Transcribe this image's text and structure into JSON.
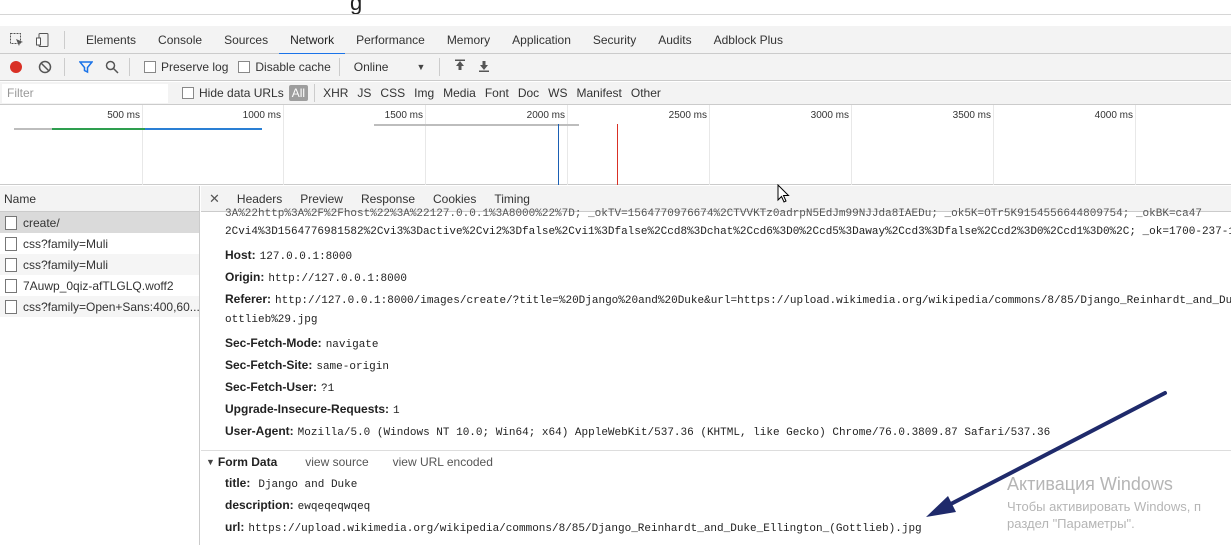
{
  "page": {
    "heading_fragment": "g"
  },
  "devtools": {
    "tabs": [
      "Elements",
      "Console",
      "Sources",
      "Network",
      "Performance",
      "Memory",
      "Application",
      "Security",
      "Audits",
      "Adblock Plus"
    ],
    "active_tab": "Network"
  },
  "toolbar": {
    "preserve_log": "Preserve log",
    "disable_cache": "Disable cache",
    "throttle": "Online"
  },
  "filter": {
    "placeholder": "Filter",
    "hide_data_urls": "Hide data URLs",
    "all": "All",
    "types": [
      "XHR",
      "JS",
      "CSS",
      "Img",
      "Media",
      "Font",
      "Doc",
      "WS",
      "Manifest",
      "Other"
    ]
  },
  "overview": {
    "ticks": [
      "500 ms",
      "1000 ms",
      "1500 ms",
      "2000 ms",
      "2500 ms",
      "3000 ms",
      "3500 ms",
      "4000 ms"
    ],
    "colors": {
      "green": "#2e9e4f",
      "blue_bar": "#2a7fd4",
      "blue_line": "#1a5fb4",
      "red_line": "#d93025"
    }
  },
  "requests": {
    "header": "Name",
    "items": [
      "create/",
      "css?family=Muli",
      "css?family=Muli",
      "7Auwp_0qiz-afTLGLQ.woff2",
      "css?family=Open+Sans:400,60..."
    ]
  },
  "detail": {
    "tabs": [
      "Headers",
      "Preview",
      "Response",
      "Cookies",
      "Timing"
    ],
    "cut_line": "3A%22http%3A%2F%2Fhost%22%3A%22127.0.0.1%3A8000%22%7D; _okTV=1564770976674%2CTVVKTz0adrpN5EdJm99NJJda8IAEDu; _ok5K=OTr5K9154556644809754; _okBK=ca47",
    "cookie_tail": "2Cvi4%3D1564776981582%2Cvi3%3Dactive%2Cvi2%3Dfalse%2Cvi1%3Dfalse%2Ccd8%3Dchat%2Ccd6%3D0%2Ccd5%3Daway%2Ccd3%3Dfalse%2Ccd2%3D0%2Ccd1%3D0%2C; _ok=1700-237-1",
    "headers": [
      {
        "k": "Host:",
        "v": "127.0.0.1:8000"
      },
      {
        "k": "Origin:",
        "v": "http://127.0.0.1:8000"
      },
      {
        "k": "Referer:",
        "v": "http://127.0.0.1:8000/images/create/?title=%20Django%20and%20Duke&url=https://upload.wikimedia.org/wikipedia/commons/8/85/Django_Reinhardt_and_Du"
      }
    ],
    "referer_tail": "ottlieb%29.jpg",
    "headers2": [
      {
        "k": "Sec-Fetch-Mode:",
        "v": "navigate"
      },
      {
        "k": "Sec-Fetch-Site:",
        "v": "same-origin"
      },
      {
        "k": "Sec-Fetch-User:",
        "v": "?1"
      },
      {
        "k": "Upgrade-Insecure-Requests:",
        "v": "1"
      },
      {
        "k": "User-Agent:",
        "v": "Mozilla/5.0 (Windows NT 10.0; Win64; x64) AppleWebKit/537.36 (KHTML, like Gecko) Chrome/76.0.3809.87 Safari/537.36"
      }
    ],
    "form_data": {
      "title": "Form Data",
      "view_source": "view source",
      "view_url_encoded": "view URL encoded",
      "fields": [
        {
          "k": "title:",
          "v": "Django and Duke"
        },
        {
          "k": "description:",
          "v": "ewqeqeqwqeq"
        },
        {
          "k": "url:",
          "v": "https://upload.wikimedia.org/wikipedia/commons/8/85/Django_Reinhardt_and_Duke_Ellington_(Gottlieb).jpg"
        }
      ]
    }
  },
  "watermark": {
    "line1": "Активация Windows",
    "line2": "Чтобы активировать Windows, п",
    "line3": "раздел \"Параметры\"."
  }
}
